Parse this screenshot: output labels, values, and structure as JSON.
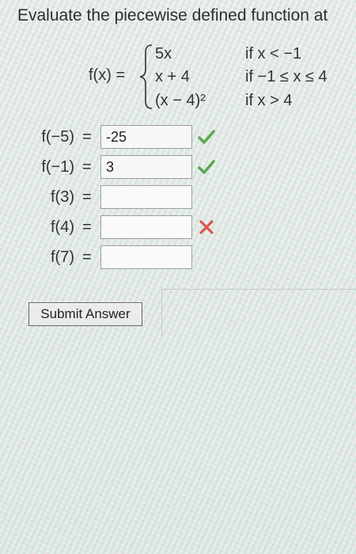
{
  "page": {
    "title": "Evaluate the piecewise defined function at"
  },
  "function": {
    "label": "f(x) =",
    "pieces": [
      {
        "expr": "5x",
        "condition": "if x < −1"
      },
      {
        "expr": "x + 4",
        "condition": "if −1 ≤ x ≤ 4"
      },
      {
        "expr": "(x − 4)²",
        "condition": "if x > 4"
      }
    ]
  },
  "rows": [
    {
      "label": "f(−5)",
      "eq": "=",
      "value": "-25",
      "status": "correct"
    },
    {
      "label": "f(−1)",
      "eq": "=",
      "value": "3",
      "status": "correct"
    },
    {
      "label": "f(3)",
      "eq": "=",
      "value": "",
      "status": "none"
    },
    {
      "label": "f(4)",
      "eq": "=",
      "value": "",
      "status": "incorrect"
    },
    {
      "label": "f(7)",
      "eq": "=",
      "value": "",
      "status": "none"
    }
  ],
  "status_icons": {
    "correct": "check-icon",
    "incorrect": "x-icon",
    "correct_color": "#5aa84f",
    "incorrect_color": "#d9574f"
  },
  "submit": {
    "label": "Submit Answer"
  }
}
